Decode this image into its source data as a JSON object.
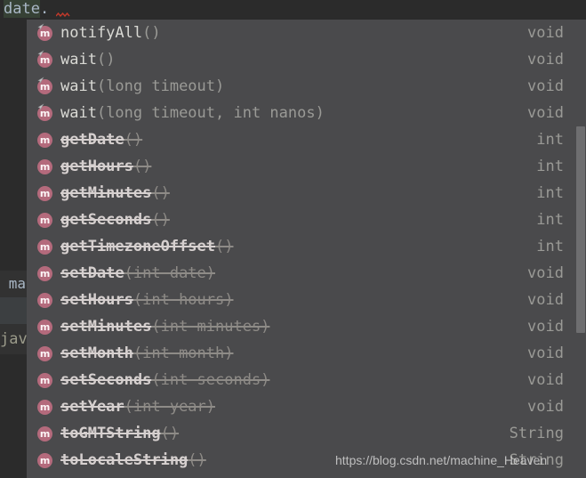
{
  "editor": {
    "current_line_prefix": "date",
    "current_line_dot": ".",
    "error_squiggle": "red-squiggly-underline",
    "behind_popup_text_1": "ma",
    "behind_popup_text_2": "java"
  },
  "popup": {
    "kind": "code-completion-popup",
    "icon_label": "m",
    "items": [
      {
        "name": "notifyAll",
        "params": "()",
        "return_type": "void",
        "deprecated": false,
        "inherited": true
      },
      {
        "name": "wait",
        "params": "()",
        "return_type": "void",
        "deprecated": false,
        "inherited": true
      },
      {
        "name": "wait",
        "params": "(long timeout)",
        "return_type": "void",
        "deprecated": false,
        "inherited": true
      },
      {
        "name": "wait",
        "params": "(long timeout, int nanos)",
        "return_type": "void",
        "deprecated": false,
        "inherited": true
      },
      {
        "name": "getDate",
        "params": "()",
        "return_type": "int",
        "deprecated": true,
        "inherited": false
      },
      {
        "name": "getHours",
        "params": "()",
        "return_type": "int",
        "deprecated": true,
        "inherited": false
      },
      {
        "name": "getMinutes",
        "params": "()",
        "return_type": "int",
        "deprecated": true,
        "inherited": false
      },
      {
        "name": "getSeconds",
        "params": "()",
        "return_type": "int",
        "deprecated": true,
        "inherited": false
      },
      {
        "name": "getTimezoneOffset",
        "params": "()",
        "return_type": "int",
        "deprecated": true,
        "inherited": false
      },
      {
        "name": "setDate",
        "params": "(int date)",
        "return_type": "void",
        "deprecated": true,
        "inherited": false
      },
      {
        "name": "setHours",
        "params": "(int hours)",
        "return_type": "void",
        "deprecated": true,
        "inherited": false
      },
      {
        "name": "setMinutes",
        "params": "(int minutes)",
        "return_type": "void",
        "deprecated": true,
        "inherited": false
      },
      {
        "name": "setMonth",
        "params": "(int month)",
        "return_type": "void",
        "deprecated": true,
        "inherited": false
      },
      {
        "name": "setSeconds",
        "params": "(int seconds)",
        "return_type": "void",
        "deprecated": true,
        "inherited": false
      },
      {
        "name": "setYear",
        "params": "(int year)",
        "return_type": "void",
        "deprecated": true,
        "inherited": false
      },
      {
        "name": "toGMTString",
        "params": "()",
        "return_type": "String",
        "deprecated": true,
        "inherited": false
      },
      {
        "name": "toLocaleString",
        "params": "()",
        "return_type": "String",
        "deprecated": true,
        "inherited": false
      }
    ],
    "scrollbar": {
      "present": true
    }
  },
  "watermark": {
    "text": "https://blog.csdn.net/machine_Heaven"
  },
  "colors": {
    "editor_background": "#2b2b2b",
    "popup_background": "#4a4a4c",
    "method_icon": "#b46a7c",
    "method_name": "#d9d9d4",
    "params": "#9a9a96",
    "return_type": "#9a9a96",
    "selection_highlight": "#364135",
    "error_underline": "#c0392b",
    "scrollbar_thumb": "#6e6e70"
  }
}
